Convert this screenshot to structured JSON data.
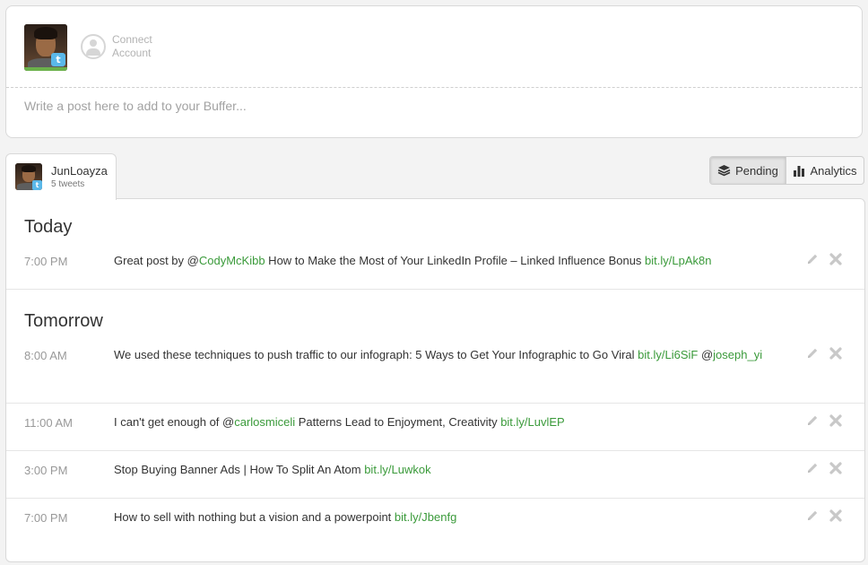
{
  "composer": {
    "connect_line1": "Connect",
    "connect_line2": "Account",
    "placeholder": "Write a post here to add to your Buffer..."
  },
  "profile_tab": {
    "name": "JunLoayza",
    "count": "5 tweets"
  },
  "view_toggle": {
    "pending": "Pending",
    "analytics": "Analytics"
  },
  "queue": {
    "days": [
      {
        "label": "Today",
        "posts": [
          {
            "time": "7:00 PM",
            "parts": [
              {
                "t": "Great post by @"
              },
              {
                "t": "CodyMcKibb",
                "link": true
              },
              {
                "t": " How to Make the Most of Your LinkedIn Profile – Linked Influence Bonus "
              },
              {
                "t": "bit.ly/LpAk8n",
                "link": true
              }
            ]
          }
        ]
      },
      {
        "label": "Tomorrow",
        "posts": [
          {
            "time": "8:00 AM",
            "parts": [
              {
                "t": "We used these techniques to push traffic to our infograph: 5 Ways to Get Your Infographic to Go Viral "
              },
              {
                "t": "bit.ly/Li6SiF",
                "link": true
              },
              {
                "t": " @"
              },
              {
                "t": "joseph_yi",
                "link": true
              }
            ]
          },
          {
            "time": "11:00 AM",
            "parts": [
              {
                "t": "I can't get enough of @"
              },
              {
                "t": "carlosmiceli",
                "link": true
              },
              {
                "t": " Patterns Lead to Enjoyment, Creativity "
              },
              {
                "t": "bit.ly/LuvlEP",
                "link": true
              }
            ]
          },
          {
            "time": "3:00 PM",
            "parts": [
              {
                "t": "Stop Buying Banner Ads | How To Split An Atom "
              },
              {
                "t": "bit.ly/Luwkok",
                "link": true
              }
            ]
          },
          {
            "time": "7:00 PM",
            "parts": [
              {
                "t": "How to sell with nothing but a vision and a powerpoint "
              },
              {
                "t": "bit.ly/Jbenfg",
                "link": true
              }
            ]
          }
        ]
      }
    ]
  },
  "colors": {
    "link": "#3a9a3a",
    "twitter": "#5ab8e9",
    "avatar_bar": "#6bb14b"
  }
}
